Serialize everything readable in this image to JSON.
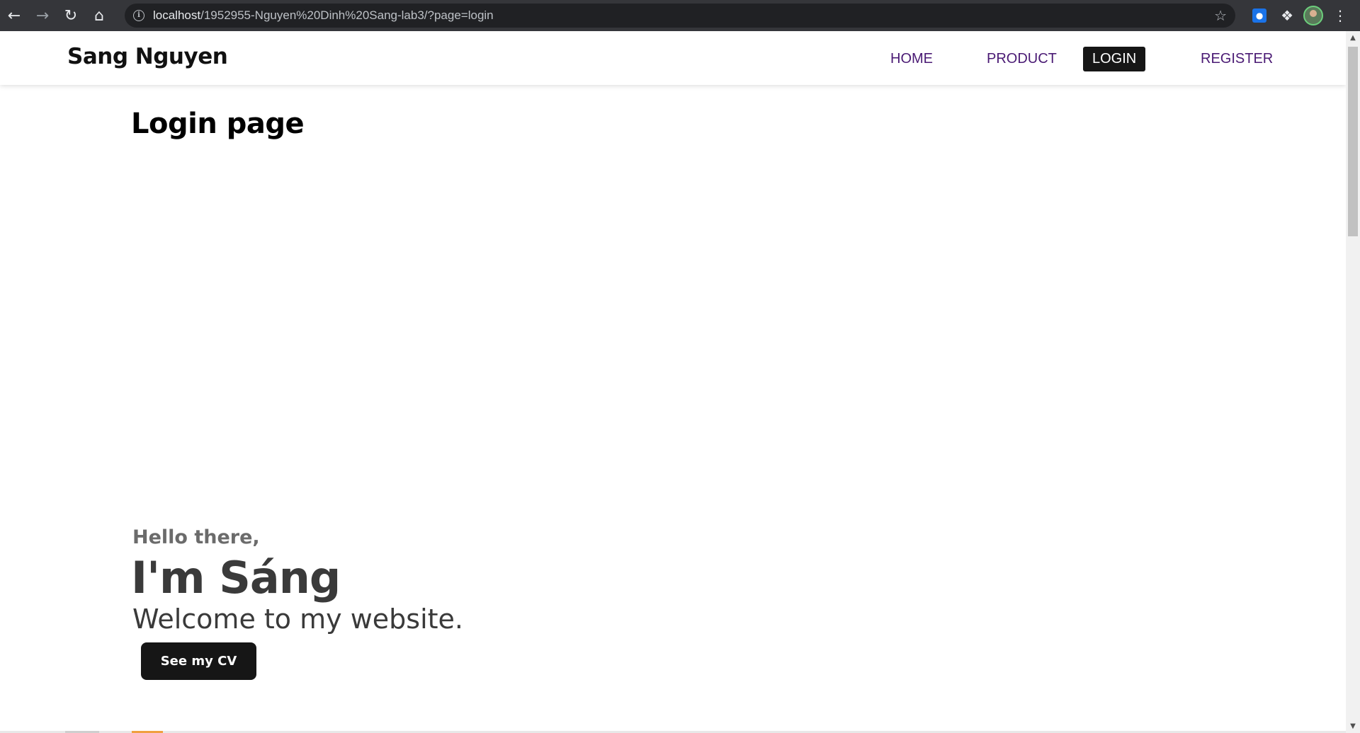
{
  "browser": {
    "url_host": "localhost",
    "url_path": "/1952955-Nguyen%20Dinh%20Sang-lab3/?page=login"
  },
  "site": {
    "brand": "Sang Nguyen",
    "nav": [
      {
        "label": "HOME",
        "active": false
      },
      {
        "label": "PRODUCT",
        "active": false
      },
      {
        "label": "LOGIN",
        "active": true
      },
      {
        "label": "REGISTER",
        "active": false
      }
    ]
  },
  "main": {
    "page_title": "Login page",
    "hero": {
      "greeting": "Hello there,",
      "name": "I'm Sáng",
      "welcome": "Welcome to my website.",
      "cv_button": "See my CV"
    }
  },
  "colors": {
    "nav_link": "#4a1a74",
    "active_bg": "#161616",
    "button_bg": "#161616"
  }
}
